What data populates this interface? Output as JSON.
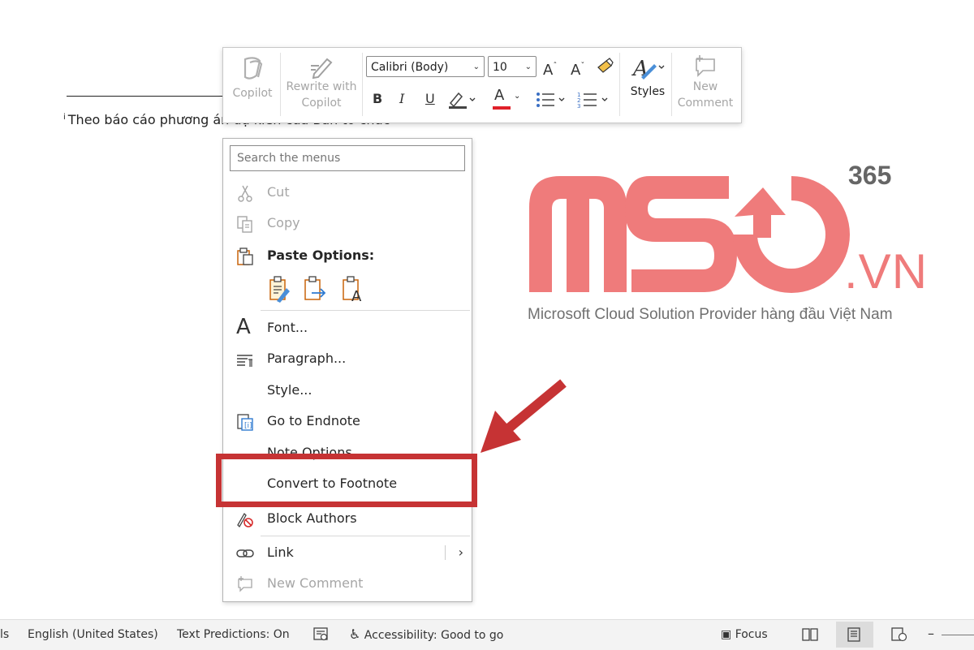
{
  "document": {
    "footnote_marker": "i",
    "footnote_text": "Theo báo cáo phương án dự kiến của Ban tổ chức"
  },
  "mini_toolbar": {
    "copilot_label": "Copilot",
    "rewrite_label_1": "Rewrite with",
    "rewrite_label_2": "Copilot",
    "font_name": "Calibri (Body)",
    "font_size": "10",
    "grow_font": "A",
    "shrink_font": "A",
    "bold": "B",
    "italic": "I",
    "underline": "U",
    "font_color_label": "A",
    "styles_label": "Styles",
    "new_comment_1": "New",
    "new_comment_2": "Comment"
  },
  "context_menu": {
    "search_placeholder": "Search the menus",
    "items": [
      {
        "label": "Cut",
        "icon": "scissors-icon",
        "disabled": true
      },
      {
        "label": "Copy",
        "icon": "copy-icon",
        "disabled": true
      },
      {
        "label": "Paste Options:",
        "icon": "paste-icon"
      },
      {
        "label": "Font...",
        "icon": "font-icon"
      },
      {
        "label": "Paragraph...",
        "icon": "paragraph-icon"
      },
      {
        "label": "Style...",
        "icon": ""
      },
      {
        "label": "Go to Endnote",
        "icon": "go-to-endnote-icon"
      },
      {
        "label": "Note Options...",
        "icon": ""
      },
      {
        "label": "Convert to Footnote",
        "icon": ""
      },
      {
        "label": "Block Authors",
        "icon": "block-authors-icon"
      },
      {
        "label": "Link",
        "icon": "link-icon"
      },
      {
        "label": "New Comment",
        "icon": "new-comment-icon",
        "disabled": true
      }
    ]
  },
  "logo": {
    "number": "365",
    "domain": ".VN",
    "tagline": "Microsoft Cloud Solution Provider hàng đầu Việt Nam",
    "color": "#ef7b7b"
  },
  "highlight_color": "#c63334",
  "status_bar": {
    "partial_left": "ls",
    "language": "English (United States)",
    "text_predictions": "Text Predictions: On",
    "accessibility": "Accessibility: Good to go",
    "focus": "Focus"
  }
}
